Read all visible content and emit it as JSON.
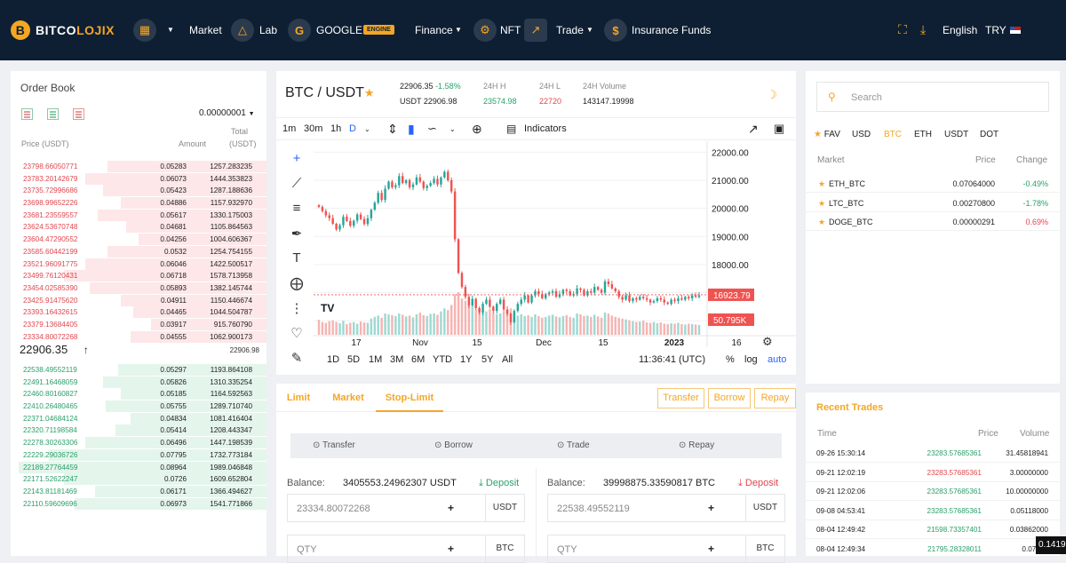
{
  "header": {
    "logo_mark": "B",
    "logo_a": "BITCO",
    "logo_b": "LOJIX",
    "nav": {
      "market": "Market",
      "lab": "Lab",
      "google": "GOOGLE",
      "engine": "ENGINE",
      "finance": "Finance",
      "nft": "NFT",
      "trade": "Trade",
      "insurance": "Insurance Funds"
    },
    "language": "English",
    "currency": "TRY"
  },
  "orderbook": {
    "title": "Order Book",
    "precision": "0.00000001",
    "col_price": "Price (USDT)",
    "col_amount": "Amount",
    "col_total_1": "Total",
    "col_total_2": "(USDT)",
    "asks": [
      {
        "p": "23798.66050771",
        "a": "0.05283",
        "t": "1257.283235",
        "d": 0.62
      },
      {
        "p": "23783.20142679",
        "a": "0.06073",
        "t": "1444.353823",
        "d": 0.71
      },
      {
        "p": "23735.72996686",
        "a": "0.05423",
        "t": "1287.188636",
        "d": 0.64
      },
      {
        "p": "23698.99652226",
        "a": "0.04886",
        "t": "1157.932970",
        "d": 0.57
      },
      {
        "p": "23681.23559557",
        "a": "0.05617",
        "t": "1330.175003",
        "d": 0.66
      },
      {
        "p": "23624.53670748",
        "a": "0.04681",
        "t": "1105.864563",
        "d": 0.55
      },
      {
        "p": "23604.47290552",
        "a": "0.04256",
        "t": "1004.606367",
        "d": 0.5
      },
      {
        "p": "23585.60442199",
        "a": "0.0532",
        "t": "1254.754155",
        "d": 0.62
      },
      {
        "p": "23521.96091775",
        "a": "0.06046",
        "t": "1422.500517",
        "d": 0.71
      },
      {
        "p": "23499.76120431",
        "a": "0.06718",
        "t": "1578.713958",
        "d": 0.79
      },
      {
        "p": "23454.02585390",
        "a": "0.05893",
        "t": "1382.145744",
        "d": 0.69
      },
      {
        "p": "23425.91475620",
        "a": "0.04911",
        "t": "1150.446674",
        "d": 0.57
      },
      {
        "p": "23393.16432615",
        "a": "0.04465",
        "t": "1044.504787",
        "d": 0.52
      },
      {
        "p": "23379.13684405",
        "a": "0.03917",
        "t": "915.760790",
        "d": 0.45
      },
      {
        "p": "23334.80072268",
        "a": "0.04555",
        "t": "1062.900173",
        "d": 0.53
      }
    ],
    "last_price": "22906.35",
    "last_sub": "22906.98",
    "bids": [
      {
        "p": "22538.49552119",
        "a": "0.05297",
        "t": "1193.864108",
        "d": 0.58
      },
      {
        "p": "22491.16468059",
        "a": "0.05826",
        "t": "1310.335254",
        "d": 0.64
      },
      {
        "p": "22460.80160827",
        "a": "0.05185",
        "t": "1164.592563",
        "d": 0.57
      },
      {
        "p": "22410.26480465",
        "a": "0.05755",
        "t": "1289.710740",
        "d": 0.63
      },
      {
        "p": "22371.04684124",
        "a": "0.04834",
        "t": "1081.416404",
        "d": 0.53
      },
      {
        "p": "22320.71198584",
        "a": "0.05414",
        "t": "1208.443347",
        "d": 0.59
      },
      {
        "p": "22278.30263306",
        "a": "0.06496",
        "t": "1447.198539",
        "d": 0.71
      },
      {
        "p": "22229.29036726",
        "a": "0.07795",
        "t": "1732.773184",
        "d": 0.85
      },
      {
        "p": "22189.27764459",
        "a": "0.08964",
        "t": "1989.046848",
        "d": 0.97
      },
      {
        "p": "22171.52622247",
        "a": "0.0726",
        "t": "1609.652804",
        "d": 0.79
      },
      {
        "p": "22143.81181469",
        "a": "0.06171",
        "t": "1366.494627",
        "d": 0.67
      },
      {
        "p": "22110.59609696",
        "a": "0.06973",
        "t": "1541.771866",
        "d": 0.75
      }
    ]
  },
  "chart_panel": {
    "pair": "BTC / USDT",
    "price": "22906.35",
    "change": "-1.58%",
    "usdt_line": "USDT 22906.98",
    "high_label": "24H H",
    "high": "23574.98",
    "low_label": "24H L",
    "low": "22720",
    "vol_label": "24H Volume",
    "vol": "143147.19998",
    "intervals": [
      "1m",
      "30m",
      "1h",
      "D"
    ],
    "indicators": "Indicators",
    "ranges": [
      "1D",
      "5D",
      "1M",
      "3M",
      "6M",
      "YTD",
      "1Y",
      "5Y",
      "All"
    ],
    "time": "11:36:41 (UTC)",
    "pct": "%",
    "log": "log",
    "auto": "auto",
    "price_tag": "16923.79",
    "vol_tag": "50.795K",
    "logo": "TV"
  },
  "chart_data": {
    "type": "candlestick",
    "y_ticks": [
      "22000.00",
      "21000.00",
      "20000.00",
      "19000.00",
      "18000.00",
      "17000.00",
      "16000.00"
    ],
    "x_ticks": [
      "17",
      "Nov",
      "15",
      "Dec",
      "15",
      "2023",
      "16"
    ],
    "ylim": [
      15500,
      22200
    ],
    "close": [
      20050,
      19900,
      19750,
      19650,
      19450,
      19250,
      19400,
      19700,
      19550,
      19380,
      19560,
      19780,
      19620,
      19440,
      19650,
      19950,
      20200,
      20550,
      20300,
      20700,
      20950,
      20750,
      20820,
      21150,
      20900,
      21000,
      20750,
      20850,
      21100,
      20950,
      20720,
      20800,
      20900,
      21050,
      20850,
      21100,
      21300,
      21000,
      20600,
      18900,
      17700,
      17200,
      16850,
      16550,
      16780,
      16450,
      16300,
      16600,
      16750,
      16500,
      16350,
      16600,
      16750,
      16400,
      16250,
      15950,
      16350,
      16600,
      16750,
      16900,
      16650,
      16900,
      17050,
      16950,
      16800,
      16950,
      17000,
      17050,
      16850,
      16950,
      17100,
      17050,
      16900,
      16950,
      17150,
      17100,
      16900,
      17050,
      17000,
      17200,
      17100,
      17000,
      17400,
      17300,
      17150,
      17050,
      16850,
      16750,
      16900,
      16700,
      16800,
      16750,
      16850,
      16800,
      16750,
      16650,
      16700,
      16800,
      16750,
      16650,
      16600,
      16750,
      16700,
      16800,
      16750,
      16850,
      16800,
      16900,
      16850,
      16900
    ],
    "volume": [
      0.35,
      0.3,
      0.28,
      0.32,
      0.34,
      0.3,
      0.27,
      0.33,
      0.25,
      0.28,
      0.3,
      0.26,
      0.31,
      0.29,
      0.28,
      0.38,
      0.42,
      0.45,
      0.4,
      0.5,
      0.48,
      0.46,
      0.44,
      0.5,
      0.47,
      0.43,
      0.45,
      0.41,
      0.48,
      0.52,
      0.46,
      0.44,
      0.49,
      0.5,
      0.47,
      0.55,
      0.62,
      0.58,
      0.7,
      0.95,
      1.0,
      0.85,
      0.8,
      0.72,
      0.68,
      0.6,
      0.62,
      0.58,
      0.55,
      0.6,
      0.52,
      0.48,
      0.5,
      0.55,
      0.58,
      0.62,
      0.5,
      0.45,
      0.48,
      0.44,
      0.46,
      0.42,
      0.48,
      0.44,
      0.4,
      0.42,
      0.45,
      0.47,
      0.43,
      0.41,
      0.44,
      0.46,
      0.42,
      0.4,
      0.5,
      0.48,
      0.44,
      0.45,
      0.42,
      0.47,
      0.43,
      0.4,
      0.52,
      0.5,
      0.45,
      0.42,
      0.4,
      0.38,
      0.36,
      0.34,
      0.32,
      0.3,
      0.31,
      0.33,
      0.29,
      0.28,
      0.3,
      0.27,
      0.29,
      0.26,
      0.25,
      0.27,
      0.26,
      0.28,
      0.25,
      0.24,
      0.26,
      0.25,
      0.24,
      0.23
    ],
    "current_price": 16923.79
  },
  "trade_panel": {
    "tabs": [
      "Limit",
      "Market",
      "Stop-Limit"
    ],
    "actions": [
      "Transfer",
      "Borrow",
      "Repay"
    ],
    "steps": [
      "Transfer",
      "Borrow",
      "Trade",
      "Repay"
    ],
    "buy": {
      "balance_label": "Balance:",
      "balance": "3405553.24962307 USDT",
      "deposit": "Deposit",
      "price": "23334.80072268",
      "unit": "USDT",
      "qty": "QTY",
      "qty_unit": "BTC"
    },
    "sell": {
      "balance_label": "Balance:",
      "balance": "39998875.33590817 BTC",
      "deposit": "Deposit",
      "price": "22538.49552119",
      "unit": "USDT",
      "qty": "QTY",
      "qty_unit": "BTC"
    },
    "plus": "+"
  },
  "market_panel": {
    "search_placeholder": "Search",
    "tabs": [
      "FAV",
      "USD",
      "BTC",
      "ETH",
      "USDT",
      "DOT"
    ],
    "col_market": "Market",
    "col_price": "Price",
    "col_change": "Change",
    "rows": [
      {
        "m": "ETH_BTC",
        "p": "0.07064000",
        "c": "-0.49%"
      },
      {
        "m": "LTC_BTC",
        "p": "0.00270800",
        "c": "-1.78%"
      },
      {
        "m": "DOGE_BTC",
        "p": "0.00000291",
        "c": "0.69%"
      }
    ]
  },
  "recent_trades": {
    "title": "Recent Trades",
    "col_time": "Time",
    "col_price": "Price",
    "col_volume": "Volume",
    "rows": [
      {
        "t": "09-26 15:30:14",
        "p": "23283.57685361",
        "v": "31.45818941",
        "side": "buy"
      },
      {
        "t": "09-21 12:02:19",
        "p": "23283.57685361",
        "v": "3.00000000",
        "side": "sell"
      },
      {
        "t": "09-21 12:02:06",
        "p": "23283.57685361",
        "v": "10.00000000",
        "side": "buy"
      },
      {
        "t": "09-08 04:53:41",
        "p": "23283.57685361",
        "v": "0.05118000",
        "side": "buy"
      },
      {
        "t": "08-04 12:49:42",
        "p": "21598.73357401",
        "v": "0.03862000",
        "side": "buy"
      },
      {
        "t": "08-04 12:49:34",
        "p": "21795.28328011",
        "v": "0.07940",
        "side": "buy"
      }
    ]
  },
  "tooltip": "0.1419",
  "colors": {
    "up": "#2aa06a",
    "down": "#e0474f",
    "accent": "#f5a623",
    "navy": "#0e1f33",
    "blue": "#2962ff"
  }
}
